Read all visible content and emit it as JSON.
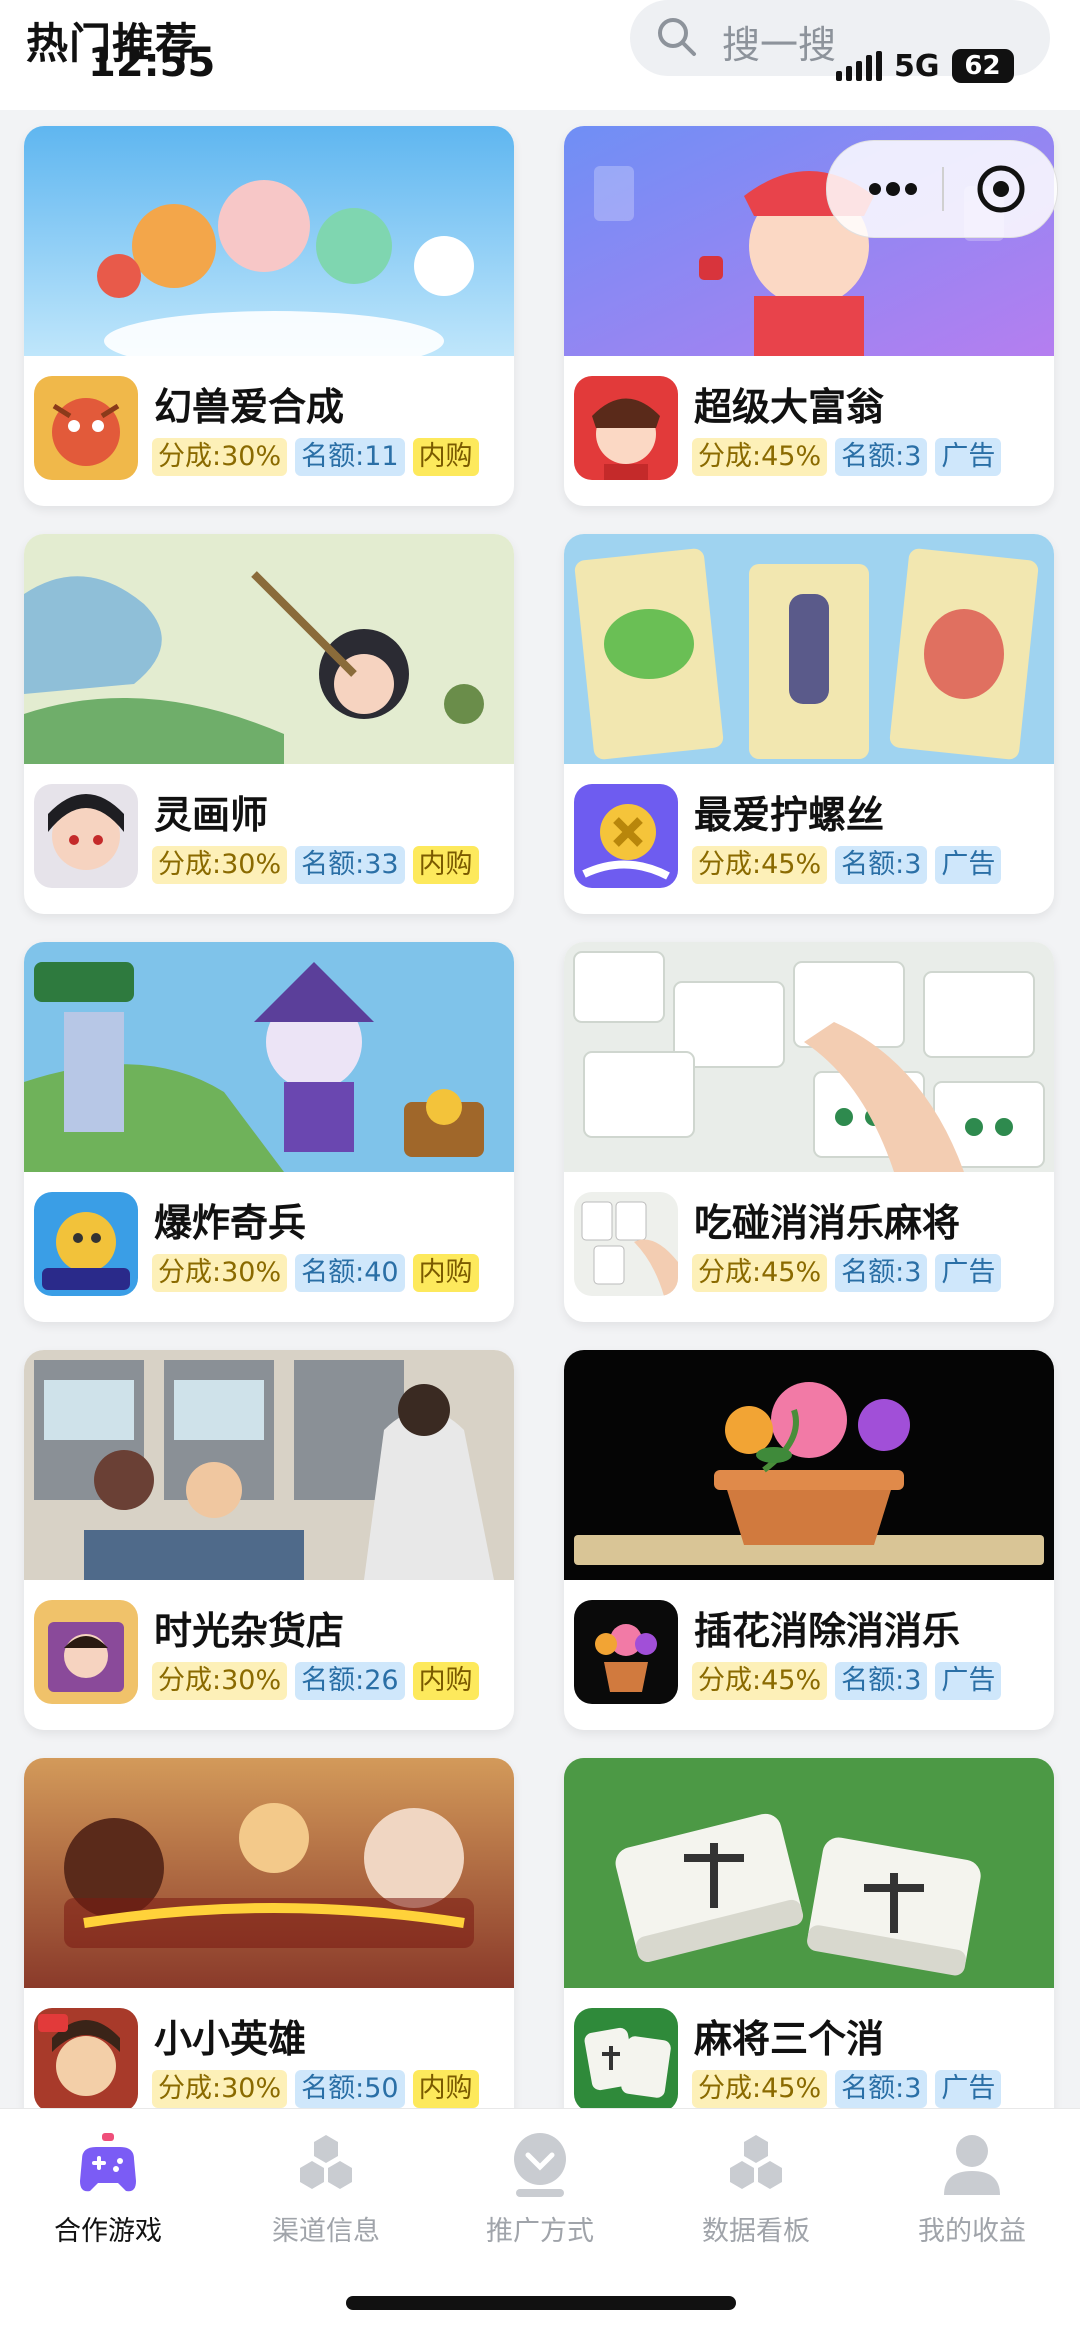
{
  "header": {
    "section_title": "热门推荐",
    "search_placeholder": "搜一搜"
  },
  "status_bar": {
    "time": "12:55",
    "network": "5G",
    "battery": "62"
  },
  "games": [
    {
      "name": "幻兽爱合成",
      "share": "分成:30%",
      "quota": "名额:11",
      "type": "内购"
    },
    {
      "name": "超级大富翁",
      "share": "分成:45%",
      "quota": "名额:3",
      "type": "广告"
    },
    {
      "name": "灵画师",
      "share": "分成:30%",
      "quota": "名额:33",
      "type": "内购"
    },
    {
      "name": "最爱拧螺丝",
      "share": "分成:45%",
      "quota": "名额:3",
      "type": "广告"
    },
    {
      "name": "爆炸奇兵",
      "share": "分成:30%",
      "quota": "名额:40",
      "type": "内购"
    },
    {
      "name": "吃碰消消乐麻将",
      "share": "分成:45%",
      "quota": "名额:3",
      "type": "广告"
    },
    {
      "name": "时光杂货店",
      "share": "分成:30%",
      "quota": "名额:26",
      "type": "内购"
    },
    {
      "name": "插花消除消消乐",
      "share": "分成:45%",
      "quota": "名额:3",
      "type": "广告"
    },
    {
      "name": "小小英雄",
      "share": "分成:30%",
      "quota": "名额:50",
      "type": "内购"
    },
    {
      "name": "麻将三个消",
      "share": "分成:45%",
      "quota": "名额:3",
      "type": "广告"
    }
  ],
  "bottom_nav": [
    {
      "label": "合作游戏",
      "active": true
    },
    {
      "label": "渠道信息",
      "active": false
    },
    {
      "label": "推广方式",
      "active": false
    },
    {
      "label": "数据看板",
      "active": false
    },
    {
      "label": "我的收益",
      "active": false
    }
  ],
  "colors": {
    "tag_share_bg": "#fdf0b8",
    "tag_quota_bg": "#cfe7fb",
    "tag_iap_bg": "#fde95c",
    "nav_active": "#7b5cf5",
    "nav_inactive": "#c9ccd1"
  }
}
